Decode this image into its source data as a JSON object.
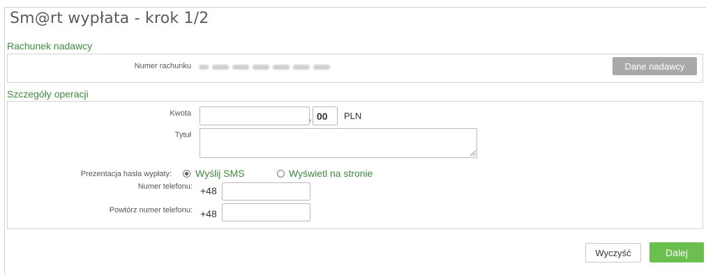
{
  "page": {
    "title": "Sm@rt wypłata - krok 1/2"
  },
  "sender_section": {
    "title": "Rachunek nadawcy",
    "account_label": "Numer rachunku",
    "sender_button": "Dane nadawcy"
  },
  "operation_section": {
    "title": "Szczegóły operacji",
    "amount_label": "Kwota",
    "amount_value": "",
    "amount_cents": "00",
    "currency": "PLN",
    "title_label": "Tytuł",
    "title_value": "",
    "password_presentation_label": "Prezentacja hasła wypłaty:",
    "radio_sms": {
      "label": "Wyślij SMS",
      "checked": true
    },
    "radio_page": {
      "label": "Wyświetl na stronie",
      "checked": false
    },
    "phone_label": "Numer telefonu:",
    "phone_prefix": "+48",
    "phone_value": "",
    "phone_repeat_label": "Powtórz numer telefonu:",
    "phone_repeat_prefix": "+48",
    "phone_repeat_value": ""
  },
  "footer": {
    "clear_button": "Wyczyść",
    "next_button": "Dalej"
  },
  "colors": {
    "accent_green": "#6bbf4e",
    "section_green": "#3d8b3d",
    "gray_button": "#a9a9a9"
  }
}
